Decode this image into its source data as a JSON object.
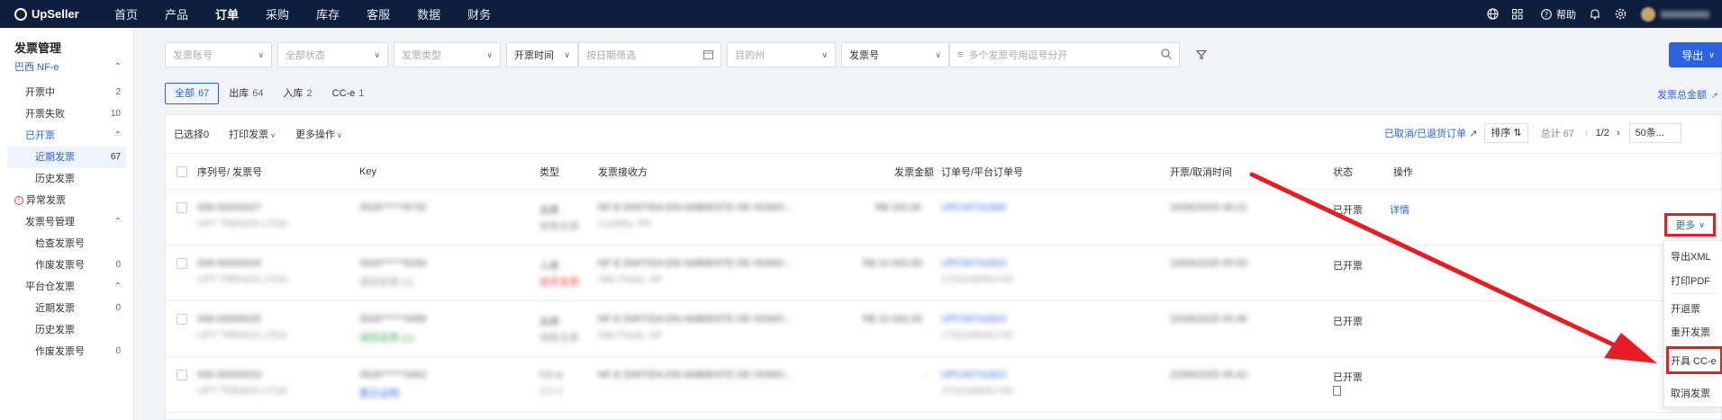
{
  "topbar": {
    "brand": "UpSeller",
    "nav": [
      "首页",
      "产品",
      "订单",
      "采购",
      "库存",
      "客服",
      "数据",
      "财务"
    ],
    "help": "帮助"
  },
  "sidebar": {
    "title": "发票管理",
    "group_brazil": "巴西 NF-e",
    "issuing": {
      "label": "开票中",
      "count": "2"
    },
    "failed": {
      "label": "开票失败",
      "count": "10"
    },
    "issued": "已开票",
    "recent": {
      "label": "近期发票",
      "count": "67"
    },
    "history": "历史发票",
    "abnormal": "异常发票",
    "number_mgmt": "发票号管理",
    "check_numbers": "检查发票号",
    "void_numbers": {
      "label": "作废发票号",
      "count": "0"
    },
    "platform_wh": "平台仓发票",
    "pw_recent": {
      "label": "近期发票",
      "count": "0"
    },
    "pw_history": "历史发票",
    "pw_void": {
      "label": "作废发票号",
      "count": "0"
    }
  },
  "filters": {
    "account": "发票账号",
    "status": "全部状态",
    "type": "发票类型",
    "time_type": "开票时间",
    "date": "按日期筛选",
    "state": "目的州",
    "search_field": "发票号",
    "search_placeholder": "多个发票号用逗号分开",
    "export": "导出"
  },
  "tabs": [
    {
      "label": "全部",
      "count": "67"
    },
    {
      "label": "出库",
      "count": "64"
    },
    {
      "label": "入库",
      "count": "2"
    },
    {
      "label": "CC-e",
      "count": "1"
    }
  ],
  "total_link": "发票总金额",
  "toolbar": {
    "selected_prefix": "已选择",
    "selected_count": "0",
    "print": "打印发票",
    "more_ops": "更多操作",
    "cancel_link": "已取消/已退货订单",
    "sort": "排序",
    "total": "总计 67",
    "page": "1/2",
    "page_size": "50条..."
  },
  "columns": {
    "serial": "序列号/ 发票号",
    "key": "Key",
    "type": "类型",
    "receiver": "发票接收方",
    "amount": "发票金额",
    "order": "订单号/平台订单号",
    "time": "开票/取消时间",
    "status": "状态",
    "actions": "操作"
  },
  "rows": [
    {
      "serial": "006-00000027",
      "company": "UPT TRENDS LTDA",
      "key": "3526******8732",
      "key_sub": "",
      "type": "出库",
      "type_sub": "销售发票",
      "receiver": "NF-E EMITIDA EM AMBIENTE DE HOMO...",
      "city": "Curitiba, PR",
      "amount": "R$ 150,00",
      "order": "UPC00741906",
      "order_sub": "",
      "time": "24/06/2025 06:21",
      "status": "已开票",
      "detail": "详情",
      "more": "更多"
    },
    {
      "serial": "006-00000026",
      "company": "UPT TRENDS LTDA",
      "key": "3526******6294",
      "key_sub": "退回发票 (1)",
      "type": "入库",
      "type_sub": "退货发票",
      "receiver": "NF-E EMITIDA EM AMBIENTE DE HOMO...",
      "city": "São Paulo, SP",
      "amount": "R$ 10.000,00",
      "order": "UPC00741823",
      "order_sub": "1732108391743",
      "time": "23/06/2025 05:53",
      "status": "已开票"
    },
    {
      "serial": "006-00000025",
      "company": "UPT TRENDS LTDA",
      "key": "3526******3466",
      "key_sub": "退回发票 (1)",
      "type": "出库",
      "type_sub": "销售发票",
      "receiver": "NF-E EMITIDA EM AMBIENTE DE HOMO...",
      "city": "São Paulo, SP",
      "amount": "R$ 10.000,00",
      "order": "UPC00741823",
      "order_sub": "1732108391743",
      "time": "22/06/2025 05:46",
      "status": "已开票"
    },
    {
      "serial": "006-00000024",
      "company": "UPT TRENDS LTDA",
      "key": "3526******3462",
      "key_sub": "更正证明",
      "type": "CC-e",
      "type_sub": "CC-e",
      "receiver": "NF-E EMITIDA EM AMBIENTE DE HOMO...",
      "city": "",
      "amount": "-",
      "order": "UPC00741823",
      "order_sub": "1732108391743",
      "time": "22/06/2025 05:42",
      "status": "已开票"
    }
  ],
  "dropdown": [
    "导出XML",
    "打印PDF",
    "开退票",
    "重开发票",
    "开具 CC-e",
    "取消发票"
  ],
  "colors": {
    "accent": "#2b63e3",
    "highlight": "#e41e24",
    "topbar": "#0d1f3c"
  }
}
